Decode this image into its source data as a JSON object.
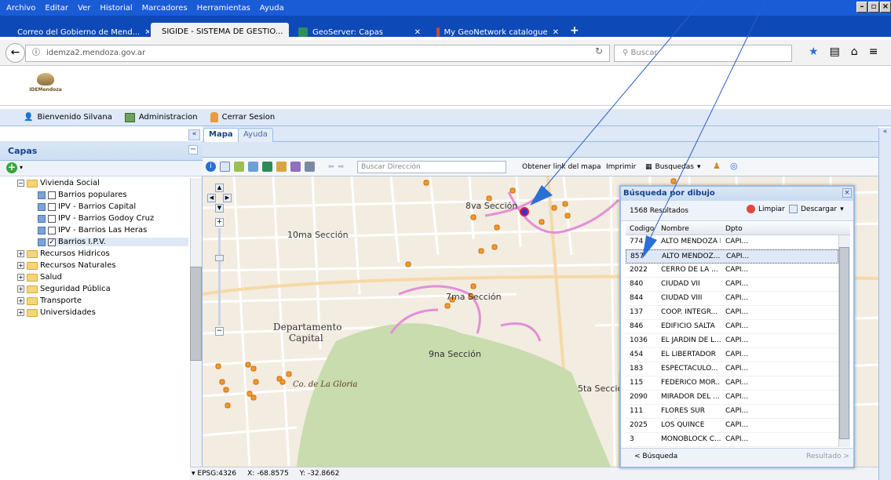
{
  "os_menu": [
    "Archivo",
    "Editar",
    "Ver",
    "Historial",
    "Marcadores",
    "Herramientas",
    "Ayuda"
  ],
  "browser_tabs": [
    {
      "label": "Correo del Gobierno de Mend...",
      "close": "✕",
      "color": "#3b7fd4",
      "active": false
    },
    {
      "label": "SIGIDE - SISTEMA DE GESTIO...",
      "close": "✕",
      "color": "#9b9b9b",
      "active": true
    },
    {
      "label": "GeoServer: Capas",
      "close": "✕",
      "color": "#2d8f5b",
      "active": false
    },
    {
      "label": "My GeoNetwork catalogue",
      "close": "✕",
      "color": "#c94c2b",
      "active": false
    }
  ],
  "new_tab": "+",
  "nav": {
    "url": "idemza2.mendoza.gov.ar",
    "search_placeholder": "Buscar"
  },
  "logo_text": "IDEMendoza",
  "user_toolbar": {
    "welcome": "Bienvenido Silvana",
    "admin": "Administracion",
    "logout": "Cerrar Sesion"
  },
  "layers": {
    "title": "Capas",
    "tree": [
      {
        "label": "Vivienda Social",
        "level": 0,
        "type": "folder",
        "expanded": true
      },
      {
        "label": "Barrios populares",
        "level": 1,
        "type": "layer",
        "checked": false
      },
      {
        "label": "IPV - Barrios Capital",
        "level": 1,
        "type": "layer",
        "checked": false
      },
      {
        "label": "IPV - Barrios Godoy Cruz",
        "level": 1,
        "type": "layer",
        "checked": false
      },
      {
        "label": "IPV - Barrios Las Heras",
        "level": 1,
        "type": "layer",
        "checked": false
      },
      {
        "label": "Barrios I.P.V.",
        "level": 1,
        "type": "layer",
        "checked": true
      },
      {
        "label": "Recursos Hidricos",
        "level": 0,
        "type": "folder",
        "expanded": false
      },
      {
        "label": "Recursos Naturales",
        "level": 0,
        "type": "folder",
        "expanded": false
      },
      {
        "label": "Salud",
        "level": 0,
        "type": "folder",
        "expanded": false
      },
      {
        "label": "Seguridad Pública",
        "level": 0,
        "type": "folder",
        "expanded": false
      },
      {
        "label": "Transporte",
        "level": 0,
        "type": "folder",
        "expanded": false
      },
      {
        "label": "Universidades",
        "level": 0,
        "type": "folder",
        "expanded": false
      }
    ]
  },
  "main_tabs": [
    {
      "label": "Mapa",
      "active": true
    },
    {
      "label": "Ayuda",
      "active": false
    }
  ],
  "map_toolbar": {
    "address_placeholder": "Buscar Dirección",
    "link": "Obtener link del mapa",
    "print": "Imprimir",
    "searches": "Busquedas"
  },
  "map_labels": [
    {
      "text": "8va Sección",
      "kind": "sec"
    },
    {
      "text": "10ma Sección",
      "kind": "sec"
    },
    {
      "text": "7ma Sección",
      "kind": "sec"
    },
    {
      "text": "Departamento",
      "kind": "dept"
    },
    {
      "text": "Capital",
      "kind": "dept"
    },
    {
      "text": "9na Sección",
      "kind": "sec"
    },
    {
      "text": "5ta Sección",
      "kind": "sec"
    },
    {
      "text": "Co. de La Gloria",
      "kind": "hill"
    }
  ],
  "status": {
    "projection": "EPSG:4326",
    "x": "X: -68.8575",
    "y": "Y: -32.8662"
  },
  "results": {
    "title": "Búsqueda por dibujo",
    "count": "1568 Resultados",
    "clear": "Limpiar",
    "download": "Descargar",
    "headers": [
      "Codigo",
      "Nombre",
      "Dpto"
    ],
    "rows": [
      [
        "774",
        "ALTO MENDOZA I",
        "CAPI..."
      ],
      [
        "857",
        "ALTO MENDOZ...",
        "CAPI..."
      ],
      [
        "2022",
        "CERRO DE LA ...",
        "CAPI..."
      ],
      [
        "840",
        "CIUDAD VII",
        "CAPI..."
      ],
      [
        "844",
        "CIUDAD VIII",
        "CAPI..."
      ],
      [
        "137",
        "COOP. INTEGR...",
        "CAPI..."
      ],
      [
        "846",
        "EDIFICIO SALTA",
        "CAPI..."
      ],
      [
        "1036",
        "EL JARDIN DE L...",
        "CAPI..."
      ],
      [
        "454",
        "EL LIBERTADOR",
        "CAPI..."
      ],
      [
        "183",
        "ESPECTACULO...",
        "CAPI..."
      ],
      [
        "115",
        "FEDERICO MOR...",
        "CAPI..."
      ],
      [
        "2090",
        "MIRADOR DEL ...",
        "CAPI..."
      ],
      [
        "111",
        "FLORES SUR",
        "CAPI..."
      ],
      [
        "2025",
        "LOS QUINCE",
        "CAPI..."
      ],
      [
        "3",
        "MONOBLOCK C...",
        "CAPI..."
      ]
    ],
    "selected_row": 1,
    "prev": "< Búsqueda",
    "next": "Resultado >"
  },
  "colors": {
    "accent": "#15428b",
    "marker": "#f39a2b",
    "route": "#e38fd8"
  }
}
